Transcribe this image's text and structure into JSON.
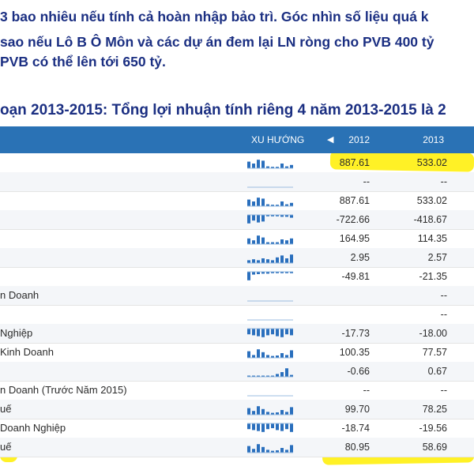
{
  "intro": {
    "line1": "3 bao nhiêu nếu tính cả hoàn nhập bảo trì. Góc nhìn số liệu quá k",
    "line2": "sao nếu Lô B Ô Môn và các dự án đem lại LN ròng cho PVB 400 tỷ",
    "line3": "PVB có thể lên tới 650 tỷ."
  },
  "heading": "oạn 2013-2015: Tổng lợi nhuận tính riêng 4 năm 2013-2015 là 2",
  "table": {
    "headers": {
      "trend": "XU HƯỚNG",
      "prev_arrow": "◀",
      "y2012": "2012",
      "y2013": "2013"
    },
    "rows": [
      {
        "label": "",
        "v2012": "887.61",
        "v2013": "533.02",
        "trend": [
          0.7,
          0.5,
          0.9,
          0.8,
          0.2,
          0.15,
          0.15,
          0.5,
          0.2,
          0.35
        ],
        "neg": false
      },
      {
        "label": "",
        "v2012": "--",
        "v2013": "--",
        "trend": [],
        "neg": false
      },
      {
        "label": "",
        "v2012": "887.61",
        "v2013": "533.02",
        "trend": [
          0.7,
          0.5,
          0.9,
          0.8,
          0.2,
          0.15,
          0.15,
          0.5,
          0.2,
          0.35
        ],
        "neg": false
      },
      {
        "label": "",
        "v2012": "-722.66",
        "v2013": "-418.67",
        "trend": [
          0.9,
          0.6,
          0.8,
          0.7,
          0.15,
          0.15,
          0.15,
          0.2,
          0.2,
          0.3
        ],
        "neg": true
      },
      {
        "label": "",
        "v2012": "164.95",
        "v2013": "114.35",
        "trend": [
          0.6,
          0.4,
          0.9,
          0.7,
          0.2,
          0.2,
          0.2,
          0.5,
          0.4,
          0.6
        ],
        "neg": false
      },
      {
        "label": "",
        "v2012": "2.95",
        "v2013": "2.57",
        "trend": [
          0.3,
          0.4,
          0.3,
          0.5,
          0.4,
          0.3,
          0.6,
          0.8,
          0.5,
          0.9
        ],
        "neg": false
      },
      {
        "label": "",
        "v2012": "-49.81",
        "v2013": "-21.35",
        "trend": [
          0.9,
          0.3,
          0.25,
          0.2,
          0.2,
          0.15,
          0.15,
          0.15,
          0.15,
          0.15
        ],
        "neg": true
      },
      {
        "label": "n Doanh",
        "v2012": "",
        "v2013": "--",
        "trend": [],
        "neg": false
      },
      {
        "label": "",
        "v2012": "",
        "v2013": "--",
        "trend": [],
        "neg": false
      },
      {
        "label": "Nghiệp",
        "v2012": "-17.73",
        "v2013": "-18.00",
        "trend": [
          0.6,
          0.7,
          0.8,
          0.9,
          0.7,
          0.6,
          0.8,
          0.9,
          0.6,
          0.7
        ],
        "neg": true
      },
      {
        "label": "Kinh Doanh",
        "v2012": "100.35",
        "v2013": "77.57",
        "trend": [
          0.7,
          0.3,
          0.9,
          0.6,
          0.3,
          0.2,
          0.25,
          0.5,
          0.3,
          0.8
        ],
        "neg": false
      },
      {
        "label": "",
        "v2012": "-0.66",
        "v2013": "0.67",
        "trend": [
          0,
          0,
          0,
          0,
          0,
          0,
          0.3,
          0.5,
          0.9,
          0.2
        ],
        "neg": false
      },
      {
        "label": "n Doanh (Trước Năm 2015)",
        "v2012": "--",
        "v2013": "--",
        "trend": [],
        "neg": false
      },
      {
        "label": "uế",
        "v2012": "99.70",
        "v2013": "78.25",
        "trend": [
          0.7,
          0.4,
          0.9,
          0.6,
          0.3,
          0.2,
          0.25,
          0.5,
          0.3,
          0.8
        ],
        "neg": false
      },
      {
        "label": "Doanh Nghiệp",
        "v2012": "-18.74",
        "v2013": "-19.56",
        "trend": [
          0.6,
          0.7,
          0.8,
          0.9,
          0.6,
          0.5,
          0.7,
          0.8,
          0.6,
          0.9
        ],
        "neg": true
      },
      {
        "label": "uế",
        "v2012": "80.95",
        "v2013": "58.69",
        "trend": [
          0.7,
          0.4,
          0.9,
          0.6,
          0.3,
          0.2,
          0.25,
          0.5,
          0.3,
          0.8
        ],
        "neg": false
      }
    ]
  },
  "colors": {
    "accent": "#2a72b5",
    "bar": "#2a6fbd",
    "text": "#1b2f82",
    "highlight": "#ffee00"
  }
}
